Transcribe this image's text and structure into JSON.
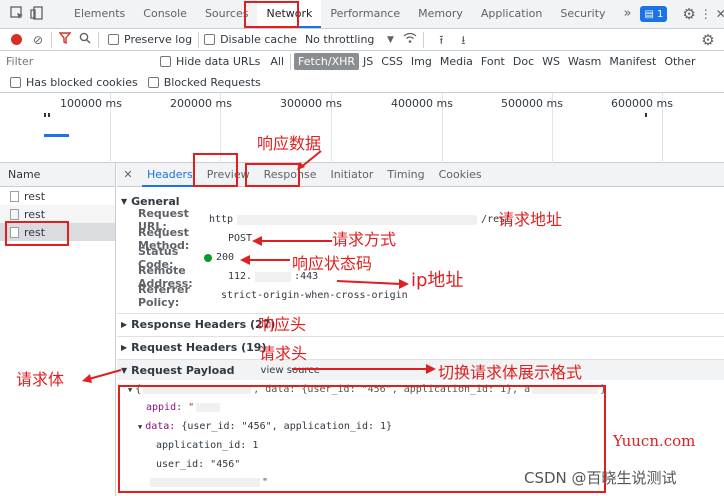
{
  "tabs": [
    "Elements",
    "Console",
    "Sources",
    "Network",
    "Performance",
    "Memory",
    "Application",
    "Security"
  ],
  "tabs_more": "»",
  "issues_badge": "1",
  "toolbar": {
    "preserve_log": "Preserve log",
    "disable_cache": "Disable cache",
    "throttling": "No throttling"
  },
  "filter": {
    "placeholder": "Filter",
    "hide_data_urls": "Hide data URLs",
    "types": [
      "All",
      "Fetch/XHR",
      "JS",
      "CSS",
      "Img",
      "Media",
      "Font",
      "Doc",
      "WS",
      "Wasm",
      "Manifest",
      "Other"
    ],
    "blocked_cookies": "Has blocked cookies",
    "blocked_requests": "Blocked Requests"
  },
  "timeline": {
    "ticks": [
      "100000 ms",
      "200000 ms",
      "300000 ms",
      "400000 ms",
      "500000 ms",
      "600000 ms"
    ]
  },
  "requests": {
    "header": "Name",
    "items": [
      "rest",
      "rest",
      "rest"
    ]
  },
  "detail_tabs": [
    "Headers",
    "Preview",
    "Response",
    "Initiator",
    "Timing",
    "Cookies"
  ],
  "general": {
    "title": "General",
    "url_label": "Request URL:",
    "url_value": "http",
    "url_tail": "/rest",
    "method_label": "Request Method:",
    "method_value": "POST",
    "status_label": "Status Code:",
    "status_value": "200",
    "remote_label": "Remote Address:",
    "remote_value": "112.",
    "remote_tail": ":443",
    "referrer_label": "Referrer Policy:",
    "referrer_value": "strict-origin-when-cross-origin"
  },
  "response_headers": "Response Headers (27)",
  "request_headers": "Request Headers (19)",
  "payload": {
    "title": "Request Payload",
    "view_source": "view source",
    "summary_start": "{",
    "summary_mid": ", data: {user_id: \"456\", application_id: 1}, a",
    "summary_end": "}",
    "appid_key": "appid:",
    "appid_val": "\"",
    "data_key": "data:",
    "data_summary": "{user_id: \"456\", application_id: 1}",
    "application_id": "application_id: 1",
    "user_id": "user_id: \"456\"",
    "last_line": "\""
  },
  "annotations": {
    "response_data": "响应数据",
    "request_url": "请求地址",
    "request_method": "请求方式",
    "status_code": "响应状态码",
    "ip": "ip地址",
    "response_headers": "响应头",
    "request_headers": "请求头",
    "request_body": "请求体",
    "switch_format": "切换请求体展示格式"
  },
  "watermarks": {
    "yuucn": "Yuucn.com",
    "csdn": "CSDN @百晓生说测试"
  },
  "colors": {
    "accent": "#1a73e8",
    "annotation": "#e02020",
    "status_ok": "#0a9a2a",
    "watermark_yuucn": "#e02020"
  }
}
